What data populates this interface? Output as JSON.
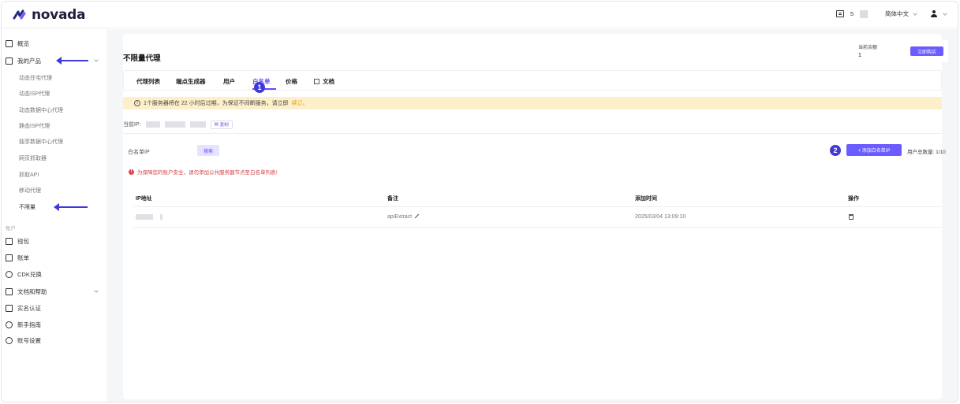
{
  "brand": {
    "name": "novada"
  },
  "topbar": {
    "message_count": "5",
    "language": "简体中文"
  },
  "sidebar": {
    "overview": "概览",
    "my_products": "我的产品",
    "sub_items": [
      "动态住宅代理",
      "动态ISP代理",
      "动态数据中心代理",
      "静态ISP代理",
      "独享数据中心代理",
      "网页抓取器",
      "抓取API",
      "移动代理",
      "不限量"
    ],
    "group_label": "账户",
    "account_items": [
      "钱包",
      "账单",
      "CDK兑换",
      "文档和帮助",
      "实名认证",
      "新手指南",
      "账号设置"
    ]
  },
  "page": {
    "title": "不限量代理",
    "count_label": "当前余额",
    "count_value": "1",
    "buy_label": "立即购买"
  },
  "tabs": [
    "代理列表",
    "端点生成器",
    "用户",
    "白名单",
    "价格",
    "文档"
  ],
  "alert": {
    "text": "1个服务器将在 22 小时后过期，为保证不间断服务，请立即",
    "link": "续订。"
  },
  "ip_row": {
    "label": "当前IP:",
    "copy_label": "复制"
  },
  "whitelist": {
    "search_label": "白名单IP",
    "search_button": "搜索",
    "add_button": "+ 添加白名单IP",
    "total_label": "用户总数量: 1/10",
    "warning": "为保障您的账户安全，请勿添加公共服务器节点至白名单列表!"
  },
  "table": {
    "headers": [
      "IP地址",
      "备注",
      "添加时间",
      "操作"
    ],
    "rows": [
      {
        "note": "apiExtract",
        "time": "2025/03/04 13:09:10"
      }
    ]
  },
  "annotations": {
    "badge_1": "1",
    "badge_2": "2"
  },
  "colors": {
    "accent": "#6a5cff",
    "annotation": "#3f39d8",
    "alert_bg": "#fcefc9",
    "warning": "#d14545"
  }
}
